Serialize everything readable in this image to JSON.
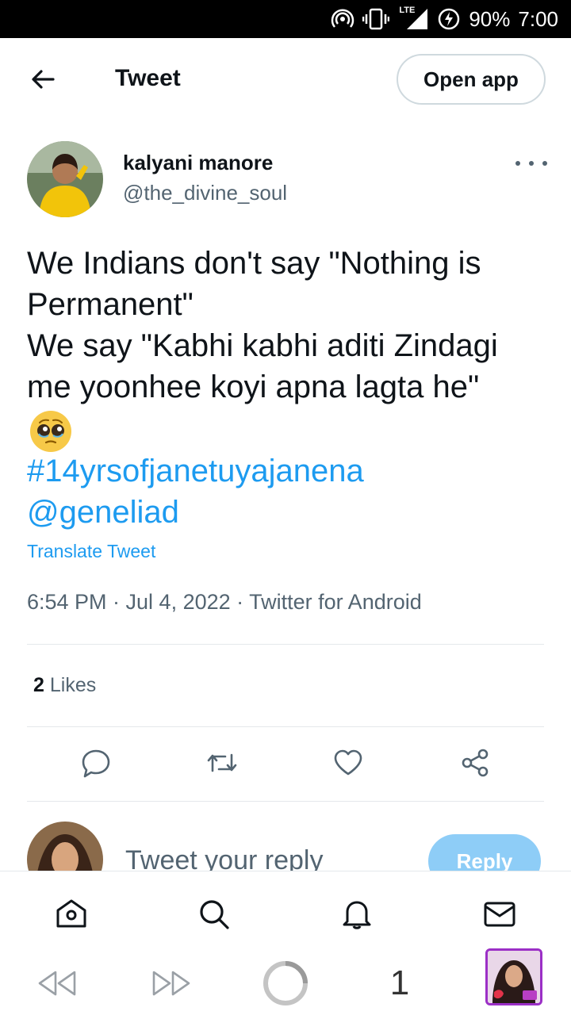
{
  "status_bar": {
    "battery": "90%",
    "time": "7:00",
    "network_label": "LTE"
  },
  "header": {
    "title": "Tweet",
    "open_app_label": "Open app"
  },
  "tweet": {
    "author_name": "kalyani manore",
    "author_handle": "@the_divine_soul",
    "text_lines": [
      "We Indians don't say \"Nothing is",
      "Permanent\"",
      "We say \"Kabhi kabhi aditi Zindagi",
      "me yoonhee koyi apna lagta he\""
    ],
    "emoji": "pleading-face",
    "hashtag": "#14yrsofjanetuyajanena",
    "mention": "@geneliad",
    "translate_label": "Translate Tweet",
    "meta": "6:54 PM · Jul 4, 2022 · Twitter for Android",
    "likes_count": "2",
    "likes_label": "Likes"
  },
  "reply": {
    "placeholder": "Tweet your reply",
    "button_label": "Reply"
  },
  "browser": {
    "tab_count": "1"
  },
  "colors": {
    "accent": "#1d9bf0",
    "reply_button": "#8ecdf7",
    "secondary_text": "#536471",
    "thumb_border": "#9b2fc6"
  }
}
